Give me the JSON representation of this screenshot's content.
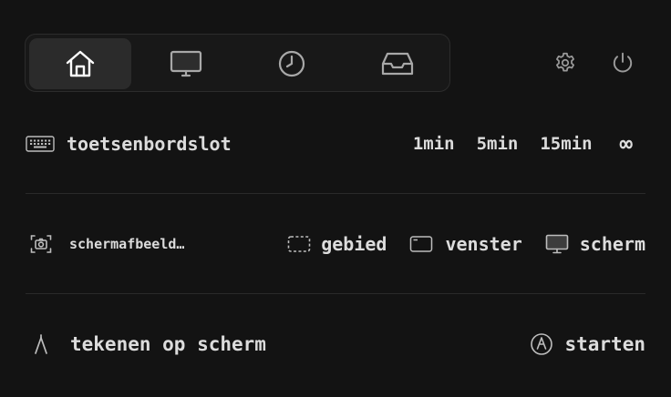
{
  "tabs": [
    {
      "icon": "home-icon",
      "active": true
    },
    {
      "icon": "display-icon",
      "active": false
    },
    {
      "icon": "clock-icon",
      "active": false
    },
    {
      "icon": "inbox-tray-icon",
      "active": false
    }
  ],
  "header": {
    "settings_icon": "gear-icon",
    "power_icon": "power-icon"
  },
  "keyboard_lock": {
    "label": "toetsenbordslot",
    "options": [
      "1min",
      "5min",
      "15min",
      "∞"
    ]
  },
  "screenshot": {
    "label": "schermafbeeld…",
    "area_label": "gebied",
    "window_label": "venster",
    "screen_label": "scherm"
  },
  "draw": {
    "label": "tekenen op scherm",
    "start_label": "starten"
  }
}
